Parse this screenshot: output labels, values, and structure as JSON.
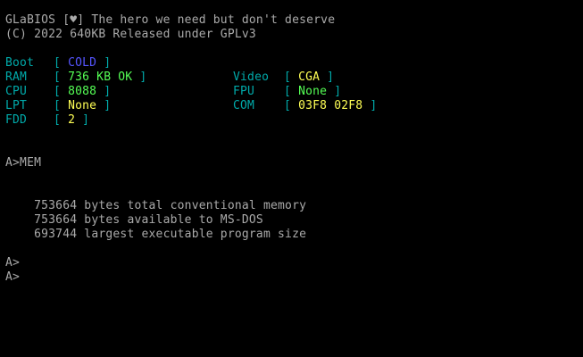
{
  "bios": {
    "line1": "GLaBIOS [♥] The hero we need but don't deserve",
    "line2": "(C) 2022 640KB Released under GPLv3"
  },
  "sysinfo": {
    "boot": {
      "label": "Boot",
      "value": "COLD"
    },
    "ram": {
      "label": "RAM",
      "value": "736 KB OK"
    },
    "cpu": {
      "label": "CPU",
      "value": "8088"
    },
    "lpt": {
      "label": "LPT",
      "value": "None"
    },
    "fdd": {
      "label": "FDD",
      "value": "2"
    },
    "video": {
      "label": "Video",
      "value": "CGA"
    },
    "fpu": {
      "label": "FPU",
      "value": "None"
    },
    "com": {
      "label": "COM",
      "value": "03F8 02F8"
    }
  },
  "console": {
    "command": "A>MEM",
    "mem_total": "    753664 bytes total conventional memory",
    "mem_avail": "    753664 bytes available to MS-DOS",
    "mem_largest": "    693744 largest executable program size",
    "prompt1": "A>",
    "prompt2": "A>"
  },
  "colors": {
    "background": "#000000",
    "text": "#aaaaaa",
    "label": "#00aaaa",
    "blue_value": "#5555ff",
    "green_value": "#55ff55",
    "yellow_value": "#ffff55"
  }
}
